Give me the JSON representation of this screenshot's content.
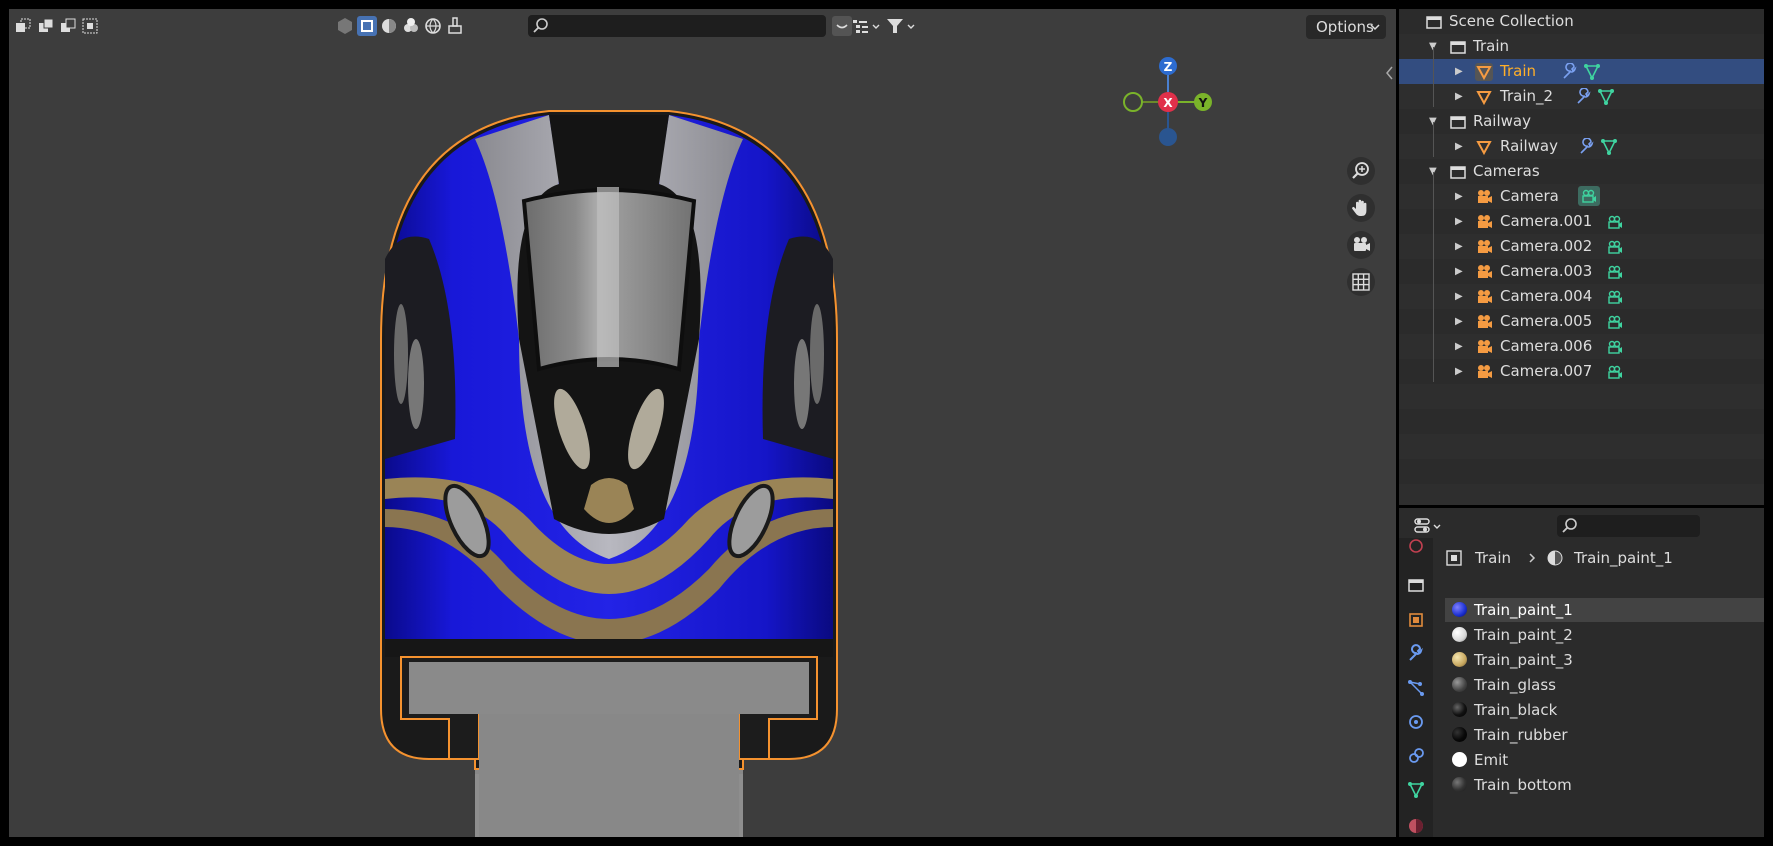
{
  "viewport": {
    "search_placeholder": "",
    "options_label": "Options",
    "gizmo": {
      "z": "Z",
      "x": "X",
      "y": "Y"
    }
  },
  "outliner": {
    "root": "Scene Collection",
    "rows": [
      {
        "label": "Train",
        "kind": "collection"
      },
      {
        "label": "Train",
        "kind": "object",
        "selected": true
      },
      {
        "label": "Train_2",
        "kind": "object"
      },
      {
        "label": "Railway",
        "kind": "collection"
      },
      {
        "label": "Railway",
        "kind": "object"
      },
      {
        "label": "Cameras",
        "kind": "collection"
      },
      {
        "label": "Camera",
        "kind": "camera"
      },
      {
        "label": "Camera.001",
        "kind": "camera"
      },
      {
        "label": "Camera.002",
        "kind": "camera"
      },
      {
        "label": "Camera.003",
        "kind": "camera"
      },
      {
        "label": "Camera.004",
        "kind": "camera"
      },
      {
        "label": "Camera.005",
        "kind": "camera"
      },
      {
        "label": "Camera.006",
        "kind": "camera"
      },
      {
        "label": "Camera.007",
        "kind": "camera"
      }
    ]
  },
  "properties": {
    "search_placeholder": "",
    "breadcrumb": {
      "object": "Train",
      "material": "Train_paint_1"
    },
    "materials": [
      {
        "label": "Train_paint_1",
        "color": "#1a2fd0",
        "selected": true
      },
      {
        "label": "Train_paint_2",
        "color": "#e8e8e8"
      },
      {
        "label": "Train_paint_3",
        "color": "#c8a860"
      },
      {
        "label": "Train_glass",
        "color": "#555555"
      },
      {
        "label": "Train_black",
        "color": "#111111"
      },
      {
        "label": "Train_rubber",
        "color": "#080808"
      },
      {
        "label": "Emit",
        "color": "#ffffff"
      },
      {
        "label": "Train_bottom",
        "color": "#333333"
      }
    ]
  },
  "colors": {
    "selection_outline": "#f5922f",
    "train_blue": "#1414c8",
    "accent_select": "#334d80"
  }
}
